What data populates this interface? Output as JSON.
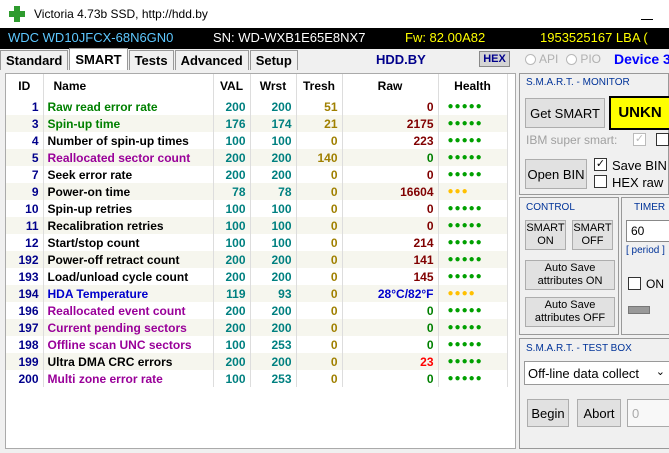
{
  "window": {
    "title": "Victoria 4.73b SSD, http://hdd.by"
  },
  "infobar": {
    "model": "WDC WD10JFCX-68N6GN0",
    "serial": "SN: WD-WXB1E65E8NX7",
    "firmware": "Fw: 82.00A82",
    "lba": "1953525167 LBA ("
  },
  "tabs": [
    {
      "label": "Standard"
    },
    {
      "label": "SMART"
    },
    {
      "label": "Tests"
    },
    {
      "label": "Advanced"
    },
    {
      "label": "Setup"
    }
  ],
  "toolbar": {
    "site": "HDD.BY",
    "hex": "HEX",
    "api": "API",
    "pio": "PIO",
    "device": "Device 3"
  },
  "table": {
    "headers": [
      "ID",
      "Name",
      "VAL",
      "Wrst",
      "Tresh",
      "Raw",
      "Health"
    ],
    "rows": [
      {
        "id": "1",
        "name": "Raw read error rate",
        "val": "200",
        "wrst": "200",
        "tresh": "51",
        "raw": "0",
        "health": "●●●●●",
        "name_color": "green",
        "raw_color": "dkred",
        "health_color": "hgreen"
      },
      {
        "id": "3",
        "name": "Spin-up time",
        "val": "176",
        "wrst": "174",
        "tresh": "21",
        "raw": "2175",
        "health": "●●●●●",
        "name_color": "green",
        "raw_color": "dkred",
        "health_color": "hgreen"
      },
      {
        "id": "4",
        "name": "Number of spin-up times",
        "val": "100",
        "wrst": "100",
        "tresh": "0",
        "raw": "223",
        "health": "●●●●●",
        "name_color": "black",
        "raw_color": "dkred",
        "health_color": "hgreen"
      },
      {
        "id": "5",
        "name": "Reallocated sector count",
        "val": "200",
        "wrst": "200",
        "tresh": "140",
        "raw": "0",
        "health": "●●●●●",
        "name_color": "purple",
        "raw_color": "green",
        "health_color": "hgreen"
      },
      {
        "id": "7",
        "name": "Seek error rate",
        "val": "200",
        "wrst": "200",
        "tresh": "0",
        "raw": "0",
        "health": "●●●●●",
        "name_color": "black",
        "raw_color": "dkred",
        "health_color": "hgreen"
      },
      {
        "id": "9",
        "name": "Power-on time",
        "val": "78",
        "wrst": "78",
        "tresh": "0",
        "raw": "16604",
        "health": "●●●",
        "name_color": "black",
        "raw_color": "dkred",
        "health_color": "hyellow"
      },
      {
        "id": "10",
        "name": "Spin-up retries",
        "val": "100",
        "wrst": "100",
        "tresh": "0",
        "raw": "0",
        "health": "●●●●●",
        "name_color": "black",
        "raw_color": "dkred",
        "health_color": "hgreen"
      },
      {
        "id": "11",
        "name": "Recalibration retries",
        "val": "100",
        "wrst": "100",
        "tresh": "0",
        "raw": "0",
        "health": "●●●●●",
        "name_color": "black",
        "raw_color": "dkred",
        "health_color": "hgreen"
      },
      {
        "id": "12",
        "name": "Start/stop count",
        "val": "100",
        "wrst": "100",
        "tresh": "0",
        "raw": "214",
        "health": "●●●●●",
        "name_color": "black",
        "raw_color": "dkred",
        "health_color": "hgreen"
      },
      {
        "id": "192",
        "name": "Power-off retract count",
        "val": "200",
        "wrst": "200",
        "tresh": "0",
        "raw": "141",
        "health": "●●●●●",
        "name_color": "black",
        "raw_color": "dkred",
        "health_color": "hgreen"
      },
      {
        "id": "193",
        "name": "Load/unload cycle count",
        "val": "200",
        "wrst": "200",
        "tresh": "0",
        "raw": "145",
        "health": "●●●●●",
        "name_color": "black",
        "raw_color": "dkred",
        "health_color": "hgreen"
      },
      {
        "id": "194",
        "name": "HDA Temperature",
        "val": "119",
        "wrst": "93",
        "tresh": "0",
        "raw": "28°C/82°F",
        "health": "●●●●",
        "name_color": "blue",
        "raw_color": "blue",
        "health_color": "hyellow"
      },
      {
        "id": "196",
        "name": "Reallocated event count",
        "val": "200",
        "wrst": "200",
        "tresh": "0",
        "raw": "0",
        "health": "●●●●●",
        "name_color": "purple",
        "raw_color": "green",
        "health_color": "hgreen"
      },
      {
        "id": "197",
        "name": "Current pending sectors",
        "val": "200",
        "wrst": "200",
        "tresh": "0",
        "raw": "0",
        "health": "●●●●●",
        "name_color": "purple",
        "raw_color": "green",
        "health_color": "hgreen"
      },
      {
        "id": "198",
        "name": "Offline scan UNC sectors",
        "val": "100",
        "wrst": "253",
        "tresh": "0",
        "raw": "0",
        "health": "●●●●●",
        "name_color": "purple",
        "raw_color": "green",
        "health_color": "hgreen"
      },
      {
        "id": "199",
        "name": "Ultra DMA CRC errors",
        "val": "200",
        "wrst": "200",
        "tresh": "0",
        "raw": "23",
        "health": "●●●●●",
        "name_color": "black",
        "raw_color": "red",
        "health_color": "hgreen"
      },
      {
        "id": "200",
        "name": "Multi zone error rate",
        "val": "100",
        "wrst": "253",
        "tresh": "0",
        "raw": "0",
        "health": "●●●●●",
        "name_color": "purple",
        "raw_color": "green",
        "health_color": "hgreen"
      }
    ]
  },
  "smart_monitor": {
    "title": "S.M.A.R.T. - MONITOR",
    "get_smart": "Get SMART",
    "status": "UNKN",
    "status_bg": "#ffff00",
    "ibm": "IBM super smart:",
    "open_bin": "Open BIN",
    "save_bin": "Save BIN",
    "hex_raw": "HEX raw"
  },
  "control": {
    "title": "CONTROL",
    "smart_on": "SMART ON",
    "smart_off": "SMART OFF",
    "autosave_on": "Auto Save attributes ON",
    "autosave_off": "Auto Save attributes OFF"
  },
  "timer": {
    "title": "TIMER",
    "value": "60",
    "period": "[ period ]",
    "on": "ON"
  },
  "test_box": {
    "title": "S.M.A.R.T. - TEST BOX",
    "mode": "Off-line data collect",
    "begin": "Begin",
    "abort": "Abort",
    "value": "0"
  }
}
